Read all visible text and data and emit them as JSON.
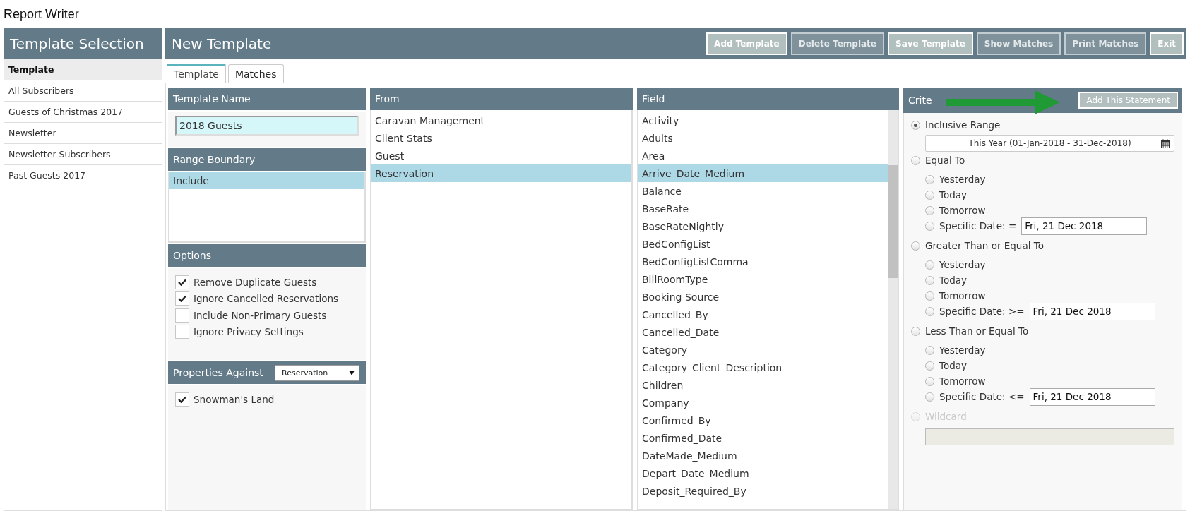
{
  "app_title": "Report Writer",
  "sidebar": {
    "title": "Template Selection",
    "items": [
      {
        "label": "Template",
        "selected": true
      },
      {
        "label": "All Subscribers",
        "selected": false
      },
      {
        "label": "Guests of Christmas 2017",
        "selected": false
      },
      {
        "label": "Newsletter",
        "selected": false
      },
      {
        "label": "Newsletter Subscribers",
        "selected": false
      },
      {
        "label": "Past Guests 2017",
        "selected": false
      }
    ]
  },
  "header": {
    "title": "New Template",
    "buttons": [
      {
        "label": "Add Template",
        "disabled": false
      },
      {
        "label": "Delete Template",
        "disabled": true
      },
      {
        "label": "Save Template",
        "disabled": false
      },
      {
        "label": "Show Matches",
        "disabled": true
      },
      {
        "label": "Print Matches",
        "disabled": true
      },
      {
        "label": "Exit",
        "disabled": false
      }
    ]
  },
  "tabs": [
    {
      "label": "Template",
      "selected": true
    },
    {
      "label": "Matches",
      "selected": false
    }
  ],
  "template_name": {
    "title": "Template Name",
    "value": "2018 Guests"
  },
  "range_boundary": {
    "title": "Range Boundary",
    "items": [
      {
        "label": "Include",
        "selected": true
      }
    ]
  },
  "options": {
    "title": "Options",
    "items": [
      {
        "label": "Remove Duplicate Guests",
        "checked": true
      },
      {
        "label": "Ignore Cancelled Reservations",
        "checked": true
      },
      {
        "label": "Include Non-Primary Guests",
        "checked": false
      },
      {
        "label": "Ignore Privacy Settings",
        "checked": false
      }
    ]
  },
  "properties": {
    "title": "Properties Against",
    "dropdown": "Reservation",
    "items": [
      {
        "label": "Snowman's Land",
        "checked": true
      }
    ]
  },
  "from": {
    "title": "From",
    "items": [
      {
        "label": "Caravan Management",
        "selected": false
      },
      {
        "label": "Client Stats",
        "selected": false
      },
      {
        "label": "Guest",
        "selected": false
      },
      {
        "label": "Reservation",
        "selected": true
      }
    ]
  },
  "field": {
    "title": "Field",
    "items": [
      {
        "label": "Activity",
        "selected": false
      },
      {
        "label": "Adults",
        "selected": false
      },
      {
        "label": "Area",
        "selected": false
      },
      {
        "label": "Arrive_Date_Medium",
        "selected": true
      },
      {
        "label": "Balance",
        "selected": false
      },
      {
        "label": "BaseRate",
        "selected": false
      },
      {
        "label": "BaseRateNightly",
        "selected": false
      },
      {
        "label": "BedConfigList",
        "selected": false
      },
      {
        "label": "BedConfigListComma",
        "selected": false
      },
      {
        "label": "BillRoomType",
        "selected": false
      },
      {
        "label": "Booking Source",
        "selected": false
      },
      {
        "label": "Cancelled_By",
        "selected": false
      },
      {
        "label": "Cancelled_Date",
        "selected": false
      },
      {
        "label": "Category",
        "selected": false
      },
      {
        "label": "Category_Client_Description",
        "selected": false
      },
      {
        "label": "Children",
        "selected": false
      },
      {
        "label": "Company",
        "selected": false
      },
      {
        "label": "Confirmed_By",
        "selected": false
      },
      {
        "label": "Confirmed_Date",
        "selected": false
      },
      {
        "label": "DateMade_Medium",
        "selected": false
      },
      {
        "label": "Depart_Date_Medium",
        "selected": false
      },
      {
        "label": "Deposit_Required_By",
        "selected": false
      }
    ]
  },
  "criteria": {
    "title": "Crite",
    "button": "Add This Statement",
    "options": [
      {
        "kind": "range",
        "label": "Inclusive Range",
        "selected": true,
        "disabled": false,
        "value": "This Year (01-Jan-2018 - 31-Dec-2018)"
      },
      {
        "kind": "group",
        "label": "Equal To",
        "selected": false,
        "disabled": false,
        "children": [
          {
            "label": "Yesterday",
            "selected": false
          },
          {
            "label": "Today",
            "selected": false
          },
          {
            "label": "Tomorrow",
            "selected": false
          },
          {
            "label": "Specific Date: =",
            "selected": false,
            "value": "Fri, 21 Dec 2018"
          }
        ]
      },
      {
        "kind": "group",
        "label": "Greater Than or Equal To",
        "selected": false,
        "disabled": false,
        "children": [
          {
            "label": "Yesterday",
            "selected": false
          },
          {
            "label": "Today",
            "selected": false
          },
          {
            "label": "Tomorrow",
            "selected": false
          },
          {
            "label": "Specific Date: >=",
            "selected": false,
            "value": "Fri, 21 Dec 2018"
          }
        ]
      },
      {
        "kind": "group",
        "label": "Less Than or Equal To",
        "selected": false,
        "disabled": false,
        "children": [
          {
            "label": "Yesterday",
            "selected": false
          },
          {
            "label": "Today",
            "selected": false
          },
          {
            "label": "Tomorrow",
            "selected": false
          },
          {
            "label": "Specific Date: <=",
            "selected": false,
            "value": "Fri, 21 Dec 2018"
          }
        ]
      },
      {
        "kind": "wildcard",
        "label": "Wildcard",
        "selected": false,
        "disabled": true
      }
    ]
  }
}
